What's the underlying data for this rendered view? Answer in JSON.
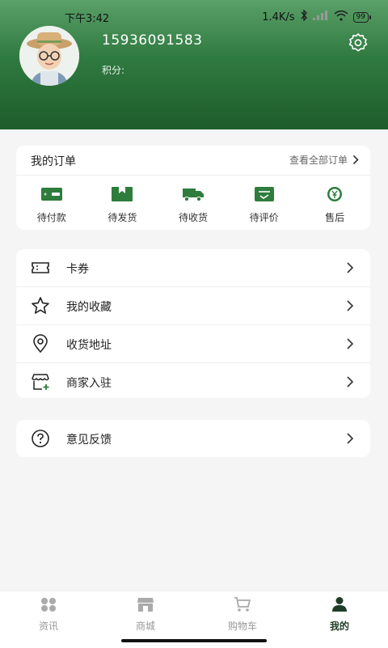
{
  "status_bar": {
    "time": "下午3:42",
    "speed": "1.4K/s",
    "battery": "99"
  },
  "profile": {
    "phone": "15936091583",
    "points_label": "积分:"
  },
  "orders": {
    "title": "我的订单",
    "view_all": "查看全部订单",
    "items": [
      {
        "label": "待付款",
        "icon": "wallet-icon"
      },
      {
        "label": "待发货",
        "icon": "package-icon"
      },
      {
        "label": "待收货",
        "icon": "truck-icon"
      },
      {
        "label": "待评价",
        "icon": "review-icon"
      },
      {
        "label": "售后",
        "icon": "yen-icon"
      }
    ]
  },
  "menu": {
    "items": [
      {
        "label": "卡券",
        "icon": "ticket-icon"
      },
      {
        "label": "我的收藏",
        "icon": "star-icon"
      },
      {
        "label": "收货地址",
        "icon": "location-pin-icon"
      },
      {
        "label": "商家入驻",
        "icon": "shop-icon"
      }
    ],
    "feedback": {
      "label": "意见反馈",
      "icon": "question-icon"
    }
  },
  "tabbar": {
    "items": [
      {
        "label": "资讯",
        "icon": "grid-icon"
      },
      {
        "label": "商城",
        "icon": "store-icon"
      },
      {
        "label": "购物车",
        "icon": "cart-icon"
      },
      {
        "label": "我的",
        "icon": "user-icon"
      }
    ],
    "active_index": 3
  },
  "colors": {
    "header_green": "#2f7a40",
    "icon_green": "#2e7d3c",
    "active_tab": "#1f3d26"
  }
}
